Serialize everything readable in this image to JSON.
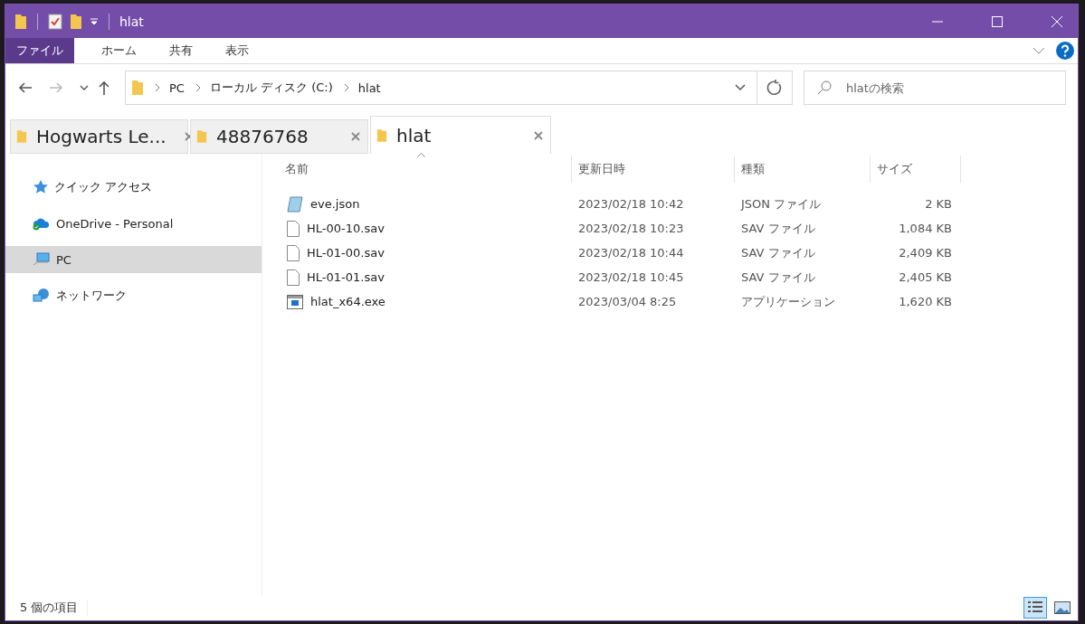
{
  "window": {
    "title": "hlat"
  },
  "ribbon_tabs": [
    {
      "label": "ファイル",
      "kind": "file-menu"
    },
    {
      "label": "ホーム",
      "kind": "tab"
    },
    {
      "label": "共有",
      "kind": "tab"
    },
    {
      "label": "表示",
      "kind": "tab"
    }
  ],
  "address": {
    "path": [
      "PC",
      "ローカル ディスク (C:)",
      "hlat"
    ]
  },
  "search": {
    "placeholder": "hlatの検索"
  },
  "folder_tabs": [
    {
      "label": "Hogwarts Le...",
      "selected": false
    },
    {
      "label": "48876768",
      "selected": false
    },
    {
      "label": "hlat",
      "selected": true
    }
  ],
  "sidebar": {
    "items": [
      {
        "label": "クイック アクセス",
        "kind": "star",
        "selected": false
      },
      {
        "label": "OneDrive - Personal",
        "kind": "cloud",
        "selected": false
      },
      {
        "label": "PC",
        "kind": "pc",
        "selected": true
      },
      {
        "label": "ネットワーク",
        "kind": "network",
        "selected": false
      }
    ]
  },
  "table": {
    "columns": [
      {
        "label": "名前",
        "sorted": true
      },
      {
        "label": "更新日時",
        "sorted": false
      },
      {
        "label": "種類",
        "sorted": false
      },
      {
        "label": "サイズ",
        "sorted": false
      }
    ],
    "rows": [
      {
        "kind": "json",
        "name": "eve.json",
        "date": "2023/02/18 10:42",
        "type": "JSON ファイル",
        "size": "2 KB"
      },
      {
        "kind": "file",
        "name": "HL-00-10.sav",
        "date": "2023/02/18 10:23",
        "type": "SAV ファイル",
        "size": "1,084 KB"
      },
      {
        "kind": "file",
        "name": "HL-01-00.sav",
        "date": "2023/02/18 10:44",
        "type": "SAV ファイル",
        "size": "2,409 KB"
      },
      {
        "kind": "file",
        "name": "HL-01-01.sav",
        "date": "2023/02/18 10:45",
        "type": "SAV ファイル",
        "size": "2,405 KB"
      },
      {
        "kind": "exe",
        "name": "hlat_x64.exe",
        "date": "2023/03/04 8:25",
        "type": "アプリケーション",
        "size": "1,620 KB"
      }
    ]
  },
  "status_bar": {
    "text": "5 個の項目",
    "views": [
      {
        "kind": "details",
        "selected": true
      },
      {
        "kind": "large-icons",
        "selected": false
      }
    ]
  }
}
